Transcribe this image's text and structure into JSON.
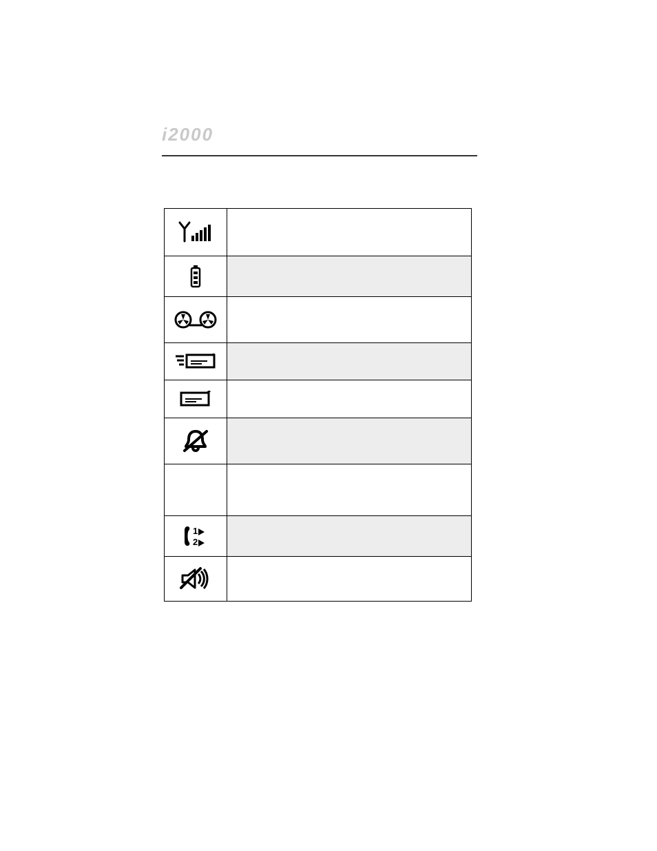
{
  "header": {
    "logo_text": "i2000"
  },
  "icons": [
    {
      "name": "signal-strength-icon",
      "description": "",
      "shaded": false
    },
    {
      "name": "battery-icon",
      "description": "",
      "shaded": true
    },
    {
      "name": "voicemail-icon",
      "description": "",
      "shaded": false
    },
    {
      "name": "message-list-icon",
      "description": "",
      "shaded": true
    },
    {
      "name": "message-icon",
      "description": "",
      "shaded": false
    },
    {
      "name": "vibrate-alert-icon",
      "description": "",
      "shaded": true
    },
    {
      "name": "blank-icon",
      "description": "",
      "shaded": false
    },
    {
      "name": "line-1-2-icon",
      "description": "",
      "shaded": true
    },
    {
      "name": "speaker-off-icon",
      "description": "",
      "shaded": false
    }
  ]
}
